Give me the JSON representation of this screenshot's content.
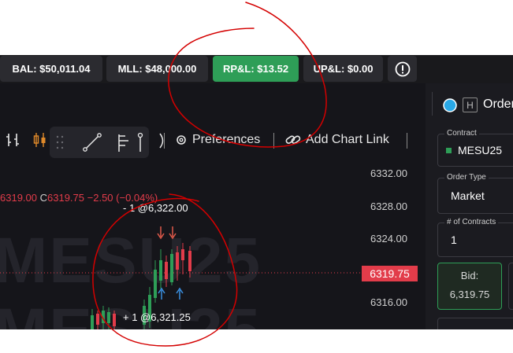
{
  "stats": {
    "bal": "BAL: $50,011.04",
    "mll": "MLL: $48,000.00",
    "rpl": "RP&L: $13.52",
    "upl": "UP&L: $0.00"
  },
  "toolbar": {
    "preferences": "Preferences",
    "add_chart_link": "Add Chart Link"
  },
  "watermark": "MESU25",
  "ohlc": {
    "low": "6319.00",
    "close_label": "C",
    "close": "6319.75",
    "change": "−2.50 (−0.04%)"
  },
  "price_axis": {
    "ticks": [
      "6332.00",
      "6328.00",
      "6324.00",
      "6316.00"
    ],
    "current": "6319.75"
  },
  "annotations": {
    "sell": "- 1 @6,322.00",
    "buy": "+ 1 @6,321.25"
  },
  "order_panel": {
    "title": "Order",
    "contract_label": "Contract",
    "contract_value": "MESU25",
    "order_type_label": "Order Type",
    "order_type_value": "Market",
    "contracts_label": "# of Contracts",
    "contracts_value": "1",
    "bid_label": "Bid:",
    "bid_value": "6,319.75"
  },
  "colors": {
    "up": "#2e9e57",
    "down": "#e23c4a",
    "marker_blue": "#3a8fe0",
    "marker_red": "#e05a4a",
    "annotation_red": "#d40000"
  }
}
